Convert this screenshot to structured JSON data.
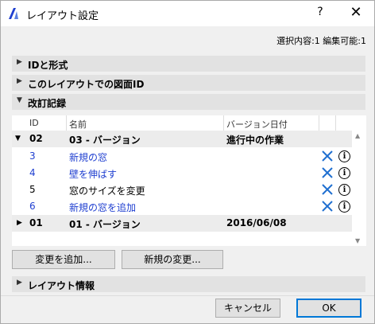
{
  "window": {
    "title": "レイアウト設定",
    "help_label": "?",
    "close_label": "✕"
  },
  "selection_info": "選択内容:1 編集可能:1",
  "sections": {
    "id_format": "IDと形式",
    "drawing_id": "このレイアウトでの図面ID",
    "revision": "改訂記録",
    "layout_info": "レイアウト情報"
  },
  "table": {
    "headers": {
      "id": "ID",
      "name": "名前",
      "date": "バージョン日付"
    },
    "groups": [
      {
        "id": "02",
        "name": "03 - バージョン",
        "date": "進行中の作業",
        "rows": [
          {
            "id": "3",
            "name": "新規の窓"
          },
          {
            "id": "4",
            "name": "壁を伸ばす"
          },
          {
            "id": "5",
            "name": "窓のサイズを変更"
          },
          {
            "id": "6",
            "name": "新規の窓を追加"
          }
        ]
      },
      {
        "id": "01",
        "name": "01 - バージョン",
        "date": "2016/06/08"
      }
    ]
  },
  "buttons": {
    "add_change": "変更を追加...",
    "new_change": "新規の変更...",
    "cancel": "キャンセル",
    "ok": "OK"
  },
  "icons": {
    "delete": "delete-x-icon",
    "info": "info-icon",
    "info_glyph": "i"
  },
  "colors": {
    "link_blue": "#1f3fd0",
    "delete_blue": "#1f6fd0",
    "ok_border": "#0078d7"
  }
}
